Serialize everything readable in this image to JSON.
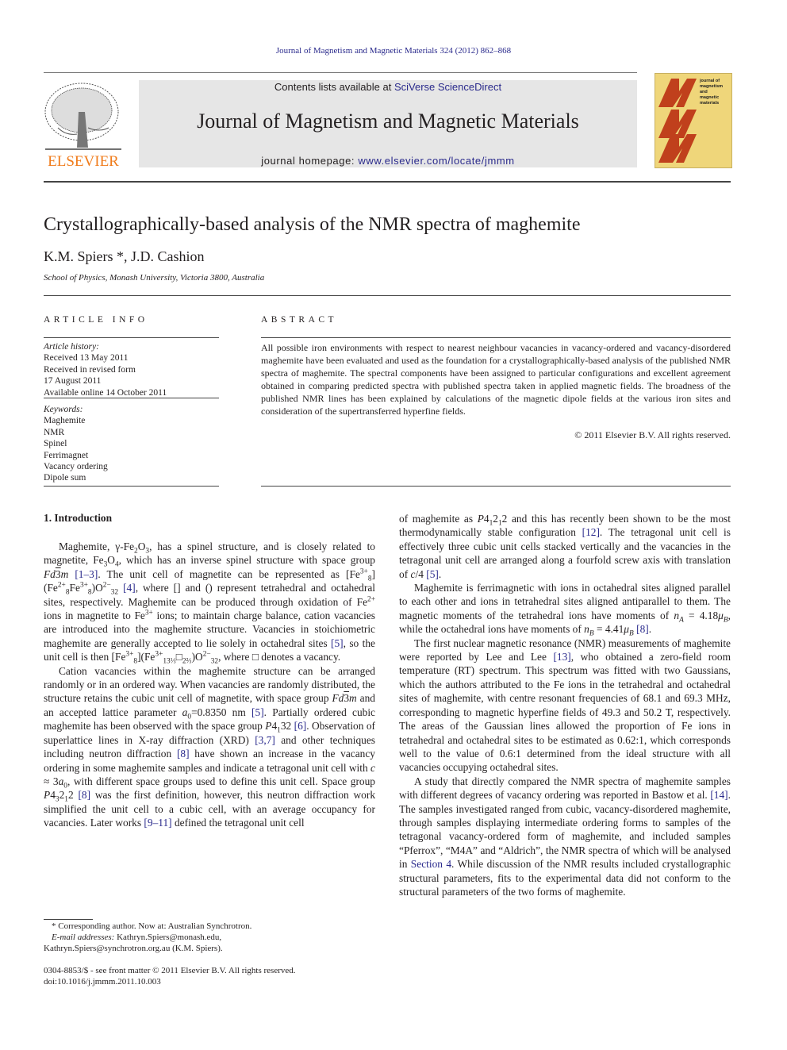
{
  "header": {
    "running_citation": "Journal of Magnetism and Magnetic Materials 324 (2012) 862–868",
    "contents_prefix": "Contents lists available at ",
    "contents_link": "SciVerse ScienceDirect",
    "journal_title": "Journal of Magnetism and Magnetic Materials",
    "homepage_prefix": "journal homepage: ",
    "homepage_link": "www.elsevier.com/locate/jmmm",
    "publisher_logo_text": "ELSEVIER",
    "cover_text": "journal of magnetism and magnetic materials",
    "colors": {
      "elsevier_orange": "#f07c1c",
      "link_blue": "#2a2a8c",
      "cover_yellow": "#efd67a",
      "cover_red": "#c0401c"
    }
  },
  "article": {
    "title": "Crystallographically-based analysis of the NMR spectra of maghemite",
    "authors": "K.M. Spiers *, J.D. Cashion",
    "affiliation": "School of Physics, Monash University, Victoria 3800, Australia"
  },
  "article_info": {
    "heading": "ARTICLE INFO",
    "history_label": "Article history:",
    "history": [
      "Received 13 May 2011",
      "Received in revised form",
      "17 August 2011",
      "Available online 14 October 2011"
    ],
    "keywords_label": "Keywords:",
    "keywords": [
      "Maghemite",
      "NMR",
      "Spinel",
      "Ferrimagnet",
      "Vacancy ordering",
      "Dipole sum"
    ]
  },
  "abstract": {
    "heading": "ABSTRACT",
    "text": "All possible iron environments with respect to nearest neighbour vacancies in vacancy-ordered and vacancy-disordered maghemite have been evaluated and used as the foundation for a crystallographically-based analysis of the published NMR spectra of maghemite. The spectral components have been assigned to particular configurations and excellent agreement obtained in comparing predicted spectra with published spectra taken in applied magnetic fields. The broadness of the published NMR lines has been explained by calculations of the magnetic dipole fields at the various iron sites and consideration of the supertransferred hyperfine fields.",
    "copyright": "© 2011 Elsevier B.V. All rights reserved."
  },
  "body": {
    "section_heading": "1.  Introduction",
    "refs": {
      "r1_3": "[1–3]",
      "r4": "[4]",
      "r5": "[5]",
      "r6": "[6]",
      "r3_7": "[3,7]",
      "r8": "[8]",
      "r9_11": "[9–11]",
      "r12": "[12]",
      "r13": "[13]",
      "r14": "[14]",
      "sec4": "Section 4"
    },
    "p1": {
      "a": "Maghemite, γ-Fe",
      "b": ", has a spinel structure, and is closely related to magnetite, Fe",
      "c": ", which has an inverse spinel structure with space group ",
      "d": ". The unit cell of magnetite can be represented as [Fe",
      "e": ", where [] and () represent tetrahedral and octahedral sites, respectively. Maghemite can be produced through oxidation of Fe",
      "f": " ions in magnetite to Fe",
      "g": " ions; to maintain charge balance, cation vacancies are introduced into the maghemite structure. Vacancies in stoichiometric maghemite are generally accepted to lie solely in octahedral sites ",
      "h": ", so the unit cell is then [Fe",
      "i": ", where □ denotes a vacancy."
    },
    "p2": {
      "a": "Cation vacancies within the maghemite structure can be arranged randomly or in an ordered way. When vacancies are randomly distributed, the structure retains the cubic unit cell of magnetite, with space group ",
      "b": " and an accepted lattice parameter ",
      "c": "=0.8350 nm ",
      "d": ". Partially ordered cubic maghemite has been observed with the space group ",
      "e": ". Observation of superlattice lines in X-ray diffraction (XRD) ",
      "f": " and other techniques including neutron diffraction ",
      "g": " have shown an increase in the vacancy ordering in some maghemite samples and indicate a tetragonal unit cell with ",
      "h": ", with different space groups used to define this unit cell. Space group ",
      "i": " was the first definition, however, this neutron diffraction work simplified the unit cell to a cubic cell, with an average occupancy for vacancies. Later works ",
      "j": " defined the tetragonal unit cell"
    },
    "p3": {
      "a": "of maghemite as ",
      "b": " and this has recently been shown to be the most thermodynamically stable configuration ",
      "c": ". The tetragonal unit cell is effectively three cubic unit cells stacked vertically and the vacancies in the tetragonal unit cell are arranged along a fourfold screw axis with translation of ",
      "d": " "
    },
    "p4": {
      "a": "Maghemite is ferrimagnetic with ions in octahedral sites aligned parallel to each other and ions in tetrahedral sites aligned antiparallel to them. The magnetic moments of the tetrahedral ions have moments of ",
      "b": ", while the octahedral ions have moments of ",
      "c": " "
    },
    "p5": {
      "a": "The first nuclear magnetic resonance (NMR) measurements of maghemite were reported by Lee and Lee ",
      "b": ", who obtained a zero-field room temperature (RT) spectrum. This spectrum was fitted with two Gaussians, which the authors attributed to the Fe ions in the tetrahedral and octahedral sites of maghemite, with centre resonant frequencies of 68.1 and 69.3 MHz, corresponding to magnetic hyperfine fields of 49.3 and 50.2 T, respectively. The areas of the Gaussian lines allowed the proportion of Fe ions in tetrahedral and octahedral sites to be estimated as 0.62:1, which corresponds well to the value of 0.6:1 determined from the ideal structure with all vacancies occupying octahedral sites."
    },
    "p6": {
      "a": "A study that directly compared the NMR spectra of maghemite samples with different degrees of vacancy ordering was reported in Bastow et al. ",
      "b": ". The samples investigated ranged from cubic, vacancy-disordered maghemite, through samples displaying intermediate ordering forms to samples of the tetragonal vacancy-ordered form of maghemite, and included samples “Pferrox”, “M4A” and “Aldrich”, the NMR spectra of which will be analysed in ",
      "c": ". While discussion of the NMR results included crystallographic structural parameters, fits to the experimental data did not conform to the structural parameters of the two forms of maghemite."
    }
  },
  "footnotes": {
    "corresponding": "* Corresponding author. Now at: Australian Synchrotron.",
    "email_label": "E-mail addresses:",
    "email1": " Kathryn.Spiers@monash.edu,",
    "email2": "Kathryn.Spiers@synchrotron.org.au (K.M. Spiers).",
    "issn": "0304-8853/$ - see front matter © 2011 Elsevier B.V. All rights reserved.",
    "doi": "doi:10.1016/j.jmmm.2011.10.003"
  }
}
